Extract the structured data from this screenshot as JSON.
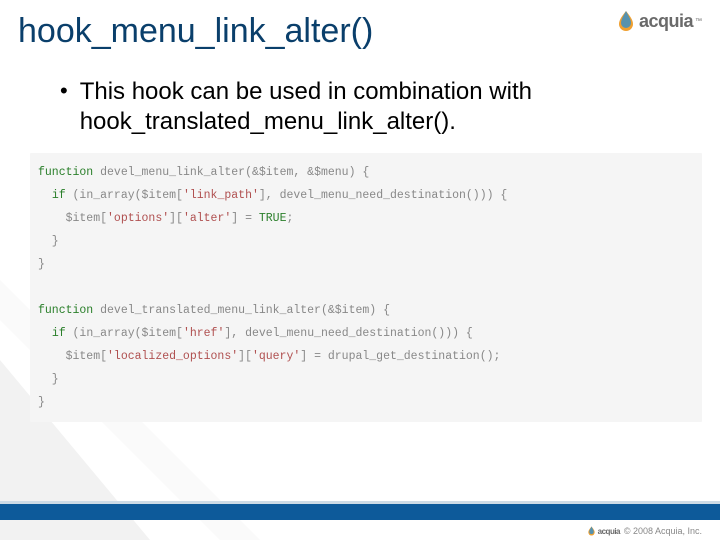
{
  "brand": {
    "name": "acquia",
    "tm": "™",
    "copyright": "© 2008 Acquia, Inc."
  },
  "title": "hook_menu_link_alter()",
  "bullet": "This hook can be used in combination with hook_translated_menu_link_alter().",
  "code": {
    "fn1": {
      "kw_function": "function",
      "name": "devel_menu_link_alter",
      "params": "(&$item, &$menu) {",
      "if_kw": "if",
      "if_open": " (in_array($item[",
      "str_link_path": "'link_path'",
      "if_mid": "], devel_menu_need_destination())) {",
      "assign_open": "    $item[",
      "str_options": "'options'",
      "assign_mid": "][",
      "str_alter": "'alter'",
      "assign_close": "] = ",
      "true_kw": "TRUE",
      "semi": ";",
      "close_if": "  }",
      "close_fn": "}"
    },
    "fn2": {
      "kw_function": "function",
      "name": "devel_translated_menu_link_alter",
      "params": "(&$item) {",
      "if_kw": "if",
      "if_open": " (in_array($item[",
      "str_href": "'href'",
      "if_mid": "], devel_menu_need_destination())) {",
      "assign_open": "    $item[",
      "str_localized": "'localized_options'",
      "assign_mid": "][",
      "str_query": "'query'",
      "assign_close": "] = drupal_get_destination();",
      "close_if": "  }",
      "close_fn": "}"
    }
  }
}
